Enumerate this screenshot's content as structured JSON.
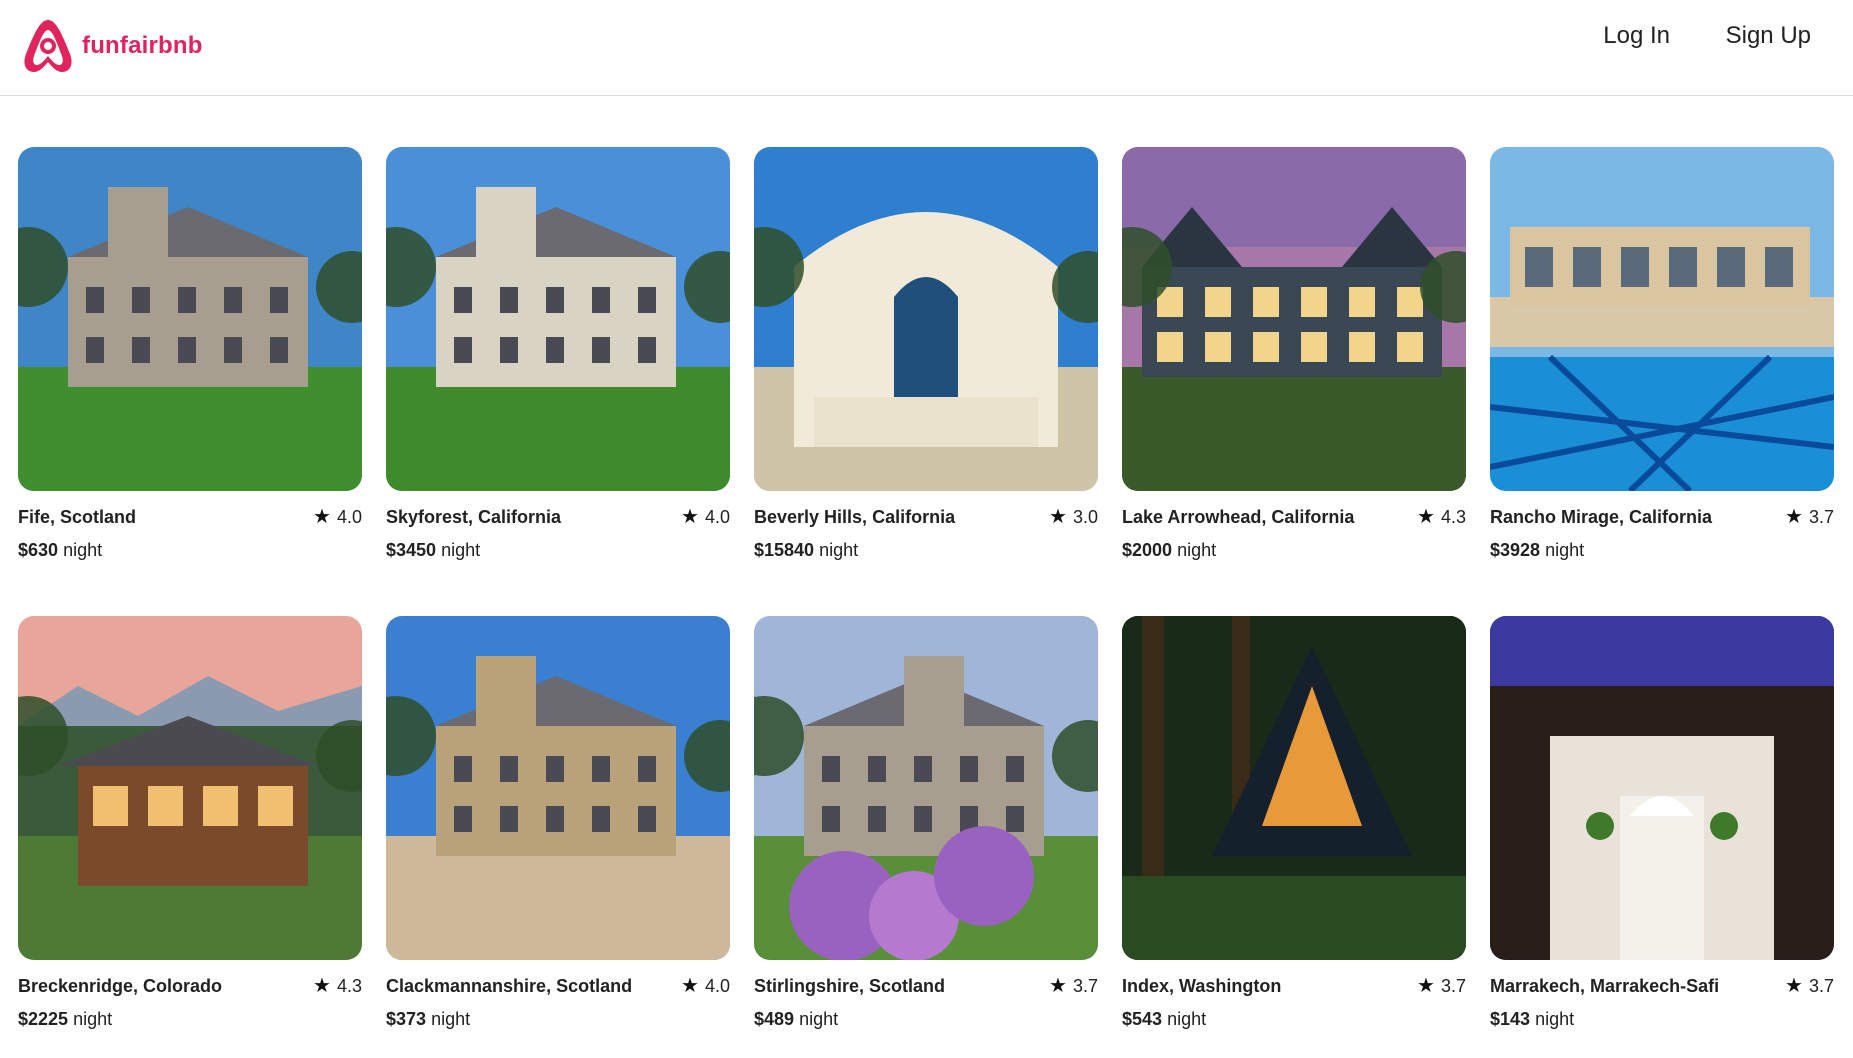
{
  "app": {
    "brand_name": "funfairbnb",
    "brand_color": "#e0245e"
  },
  "nav": {
    "login_label": "Log In",
    "signup_label": "Sign Up"
  },
  "listings": [
    {
      "location": "Fife, Scotland",
      "rating": "4.0",
      "price": "$630",
      "unit": "night",
      "scene": "manor-house",
      "sky": "#3f86c9",
      "ground": "#3f8f2f"
    },
    {
      "location": "Skyforest, California",
      "rating": "4.0",
      "price": "$3450",
      "unit": "night",
      "scene": "tudor-castle",
      "sky": "#4a90d9",
      "ground": "#3f8a2a"
    },
    {
      "location": "Beverly Hills, California",
      "rating": "3.0",
      "price": "$15840",
      "unit": "night",
      "scene": "baroque-palace",
      "sky": "#2f7fd0",
      "ground": "#cfc3a8"
    },
    {
      "location": "Lake Arrowhead, California",
      "rating": "4.3",
      "price": "$2000",
      "unit": "night",
      "scene": "victorian-lodge",
      "sky": "#a777a8",
      "ground": "#3a5a2a"
    },
    {
      "location": "Rancho Mirage, California",
      "rating": "3.7",
      "price": "$3928",
      "unit": "night",
      "scene": "pool-villa",
      "sky": "#7cb8e6",
      "ground": "#1a8fd6"
    },
    {
      "location": "Breckenridge, Colorado",
      "rating": "4.3",
      "price": "$2225",
      "unit": "night",
      "scene": "log-cabin",
      "sky": "#e8a59a",
      "ground": "#4f7a35"
    },
    {
      "location": "Clackmannanshire, Scotland",
      "rating": "4.0",
      "price": "$373",
      "unit": "night",
      "scene": "stone-castle",
      "sky": "#3a7fd0",
      "ground": "#cdb99a"
    },
    {
      "location": "Stirlingshire, Scotland",
      "rating": "3.7",
      "price": "$489",
      "unit": "night",
      "scene": "tower-house",
      "sky": "#9fb6d8",
      "ground": "#5a8f3a"
    },
    {
      "location": "Index, Washington",
      "rating": "3.7",
      "price": "$543",
      "unit": "night",
      "scene": "a-frame",
      "sky": "#1f3020",
      "ground": "#2a4a22"
    },
    {
      "location": "Marrakech, Marrakech-Safi",
      "rating": "3.7",
      "price": "$143",
      "unit": "night",
      "scene": "riad-courtyard",
      "sky": "#3a3aa0",
      "ground": "#e8e2d8"
    }
  ]
}
